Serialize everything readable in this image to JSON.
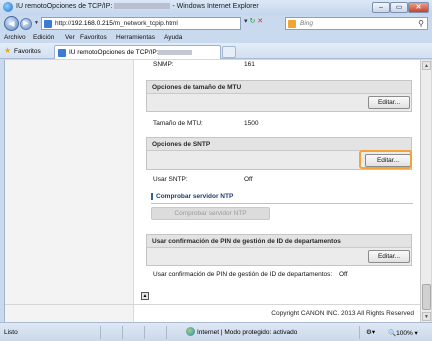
{
  "window": {
    "title_prefix": "IU remotoOpciones de TCP/IP:",
    "title_suffix": "- Windows Internet Explorer",
    "min_label": "–",
    "max_label": "▭",
    "close_label": "✕"
  },
  "address": {
    "url_prefix": "http://",
    "url_host": "192.168.0.215",
    "url_path": "/m_network_tcpip.html",
    "search_placeholder": "Bing"
  },
  "menu": [
    "Archivo",
    "Edición",
    "Ver",
    "Favoritos",
    "Herramientas",
    "Ayuda"
  ],
  "favorites": {
    "label": "Favoritos",
    "tab_title": "IU remotoOpciones de TCP/IP:"
  },
  "page": {
    "snmp_label": "SNMP:",
    "snmp_value": "161",
    "mtu_section_title": "Opciones de tamaño de MTU",
    "mtu_edit": "Editar...",
    "mtu_label": "Tamaño de MTU:",
    "mtu_value": "1500",
    "sntp_section_title": "Opciones de SNTP",
    "sntp_edit": "Editar...",
    "sntp_use_label": "Usar SNTP:",
    "sntp_use_value": "Off",
    "ntp_check_title": "Comprobar servidor NTP",
    "ntp_check_button": "Comprobar servidor NTP",
    "pin_section_title": "Usar confirmación de PIN de gestión de ID de departamentos",
    "pin_edit": "Editar...",
    "pin_label": "Usar confirmación de PIN de gestión de ID de departamentos:",
    "pin_value": "Off",
    "copyright": "Copyright CANON INC. 2013 All Rights Reserved"
  },
  "status": {
    "left": "Listo",
    "zone": "Internet | Modo protegido: activado",
    "zoom": "100%"
  },
  "colors": {
    "highlight": "#f0a43a",
    "section_bg": "#ebebeb",
    "ntp_title": "#1c3d6e"
  }
}
